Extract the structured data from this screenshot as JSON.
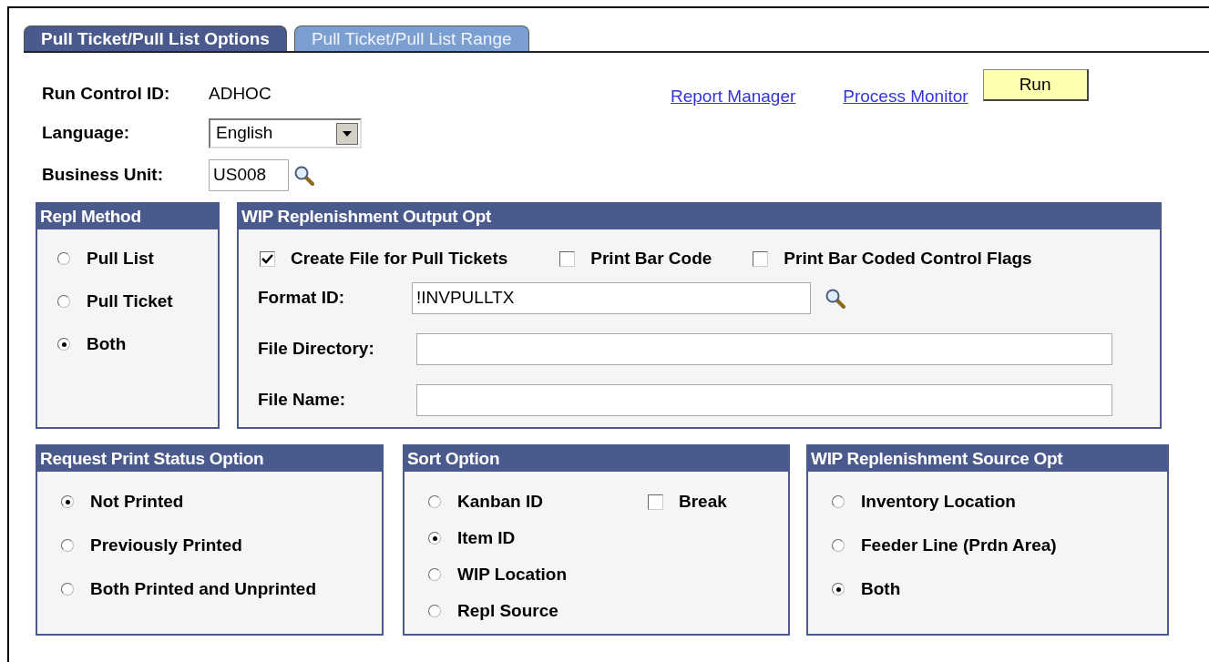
{
  "tabs": [
    {
      "label": "Pull Ticket/Pull List Options",
      "selected": true
    },
    {
      "label": "Pull Ticket/Pull List Range",
      "selected": false
    }
  ],
  "header_fields": [
    {
      "kind": "text",
      "label": "Run Control ID:",
      "value": "ADHOC"
    },
    {
      "kind": "select",
      "label": "Language:",
      "value": "English"
    },
    {
      "kind": "lookup",
      "label": "Business Unit:",
      "value": "US008"
    }
  ],
  "links": [
    "Report Manager",
    "Process Monitor"
  ],
  "run_button": "Run",
  "repl_method": {
    "title": "Repl Method",
    "options": [
      {
        "label": "Pull List",
        "selected": false
      },
      {
        "label": "Pull Ticket",
        "selected": false
      },
      {
        "label": "Both",
        "selected": true
      }
    ]
  },
  "output_opt": {
    "title": "WIP Replenishment Output Opt",
    "checkboxes": [
      {
        "label": "Create File for Pull Tickets",
        "checked": true
      },
      {
        "label": "Print Bar Code",
        "checked": false
      },
      {
        "label": "Print Bar Coded Control Flags",
        "checked": false
      }
    ],
    "fields": [
      {
        "label": "Format ID:",
        "value": "!INVPULLTX",
        "lookup": true
      },
      {
        "label": "File Directory:",
        "lookup": false
      },
      {
        "label": "File Name:",
        "lookup": false
      }
    ]
  },
  "print_status": {
    "title": "Request Print Status Option",
    "options": [
      {
        "label": "Not Printed",
        "selected": true
      },
      {
        "label": "Previously Printed",
        "selected": false
      },
      {
        "label": "Both Printed and Unprinted",
        "selected": false
      }
    ]
  },
  "sort_option": {
    "title": "Sort Option",
    "options": [
      {
        "label": "Kanban ID",
        "selected": false
      },
      {
        "label": "Item ID",
        "selected": true
      },
      {
        "label": "WIP Location",
        "selected": false
      },
      {
        "label": "Repl Source",
        "selected": false
      }
    ],
    "break": {
      "label": "Break",
      "checked": false
    }
  },
  "source_opt": {
    "title": "WIP Replenishment Source Opt",
    "options": [
      {
        "label": "Inventory Location",
        "selected": false
      },
      {
        "label": "Feeder Line (Prdn Area)",
        "selected": false
      },
      {
        "label": "Both",
        "selected": true
      }
    ]
  }
}
